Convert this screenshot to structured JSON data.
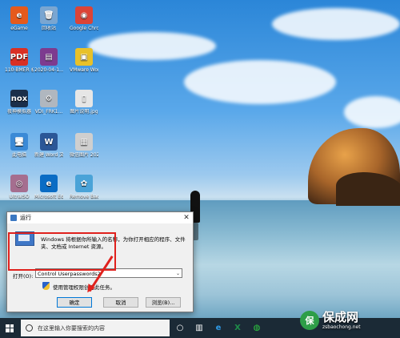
{
  "desktop_icons": [
    {
      "label": "eGame",
      "glyph": "e",
      "color": "#e55a1c"
    },
    {
      "label": "回收站",
      "glyph": "🗑",
      "color": "#7aa6d1"
    },
    {
      "label": "Google Chrome",
      "glyph": "◉",
      "color": "#db4437"
    },
    {
      "label": "110-BMER 初始化工具",
      "glyph": "PDF",
      "color": "#d93025"
    },
    {
      "label": "2020-04-1...",
      "glyph": "▤",
      "color": "#7d3b8f"
    },
    {
      "label": "VMware Workstati...",
      "glyph": "▣",
      "color": "#e8c12a"
    },
    {
      "label": "夜神模拟器",
      "glyph": "nox",
      "color": "#1b2f4a"
    },
    {
      "label": "VDI_FRK1...",
      "glyph": "⚙",
      "color": "#b0b7bf"
    },
    {
      "label": "图片说明.jpg",
      "glyph": "▯",
      "color": "#e6e6e6"
    },
    {
      "label": "此电脑",
      "glyph": "🖥",
      "color": "#3b8ad6"
    },
    {
      "label": "新建 Word 文档",
      "glyph": "W",
      "color": "#2b5797"
    },
    {
      "label": "微信图片 20200412...",
      "glyph": "▦",
      "color": "#cfcfcf"
    },
    {
      "label": "UltraISO",
      "glyph": "◎",
      "color": "#a56e8f"
    },
    {
      "label": "Microsoft Edge",
      "glyph": "e",
      "color": "#0a6cc4"
    },
    {
      "label": "Remove Background",
      "glyph": "✿",
      "color": "#4aa3d8"
    }
  ],
  "run_dialog": {
    "title": "运行",
    "close_glyph": "✕",
    "description": "Windows 将根据你所输入的名称，为你打开相应的程序、文件夹、文档或 Internet 资源。",
    "open_label": "打开(O):",
    "open_value": "Control Userpasswords2",
    "dropdown_glyph": "⌄",
    "admin_note": "使用管理权限创建此任务。",
    "ok_label": "确定",
    "cancel_label": "取消",
    "browse_label": "浏览(B)..."
  },
  "taskbar": {
    "search_placeholder": "在这里输入你要搜索的内容",
    "icons": [
      {
        "name": "task-view-icon",
        "glyph": "○"
      },
      {
        "name": "taskbar-apps-icon",
        "glyph": "▥"
      },
      {
        "name": "taskbar-edge-icon",
        "glyph": "e"
      },
      {
        "name": "taskbar-excel-icon",
        "glyph": "X"
      },
      {
        "name": "taskbar-wechat-icon",
        "glyph": "◍"
      }
    ]
  },
  "watermark": {
    "title": "保成网",
    "url": "zsbaochong.net"
  }
}
